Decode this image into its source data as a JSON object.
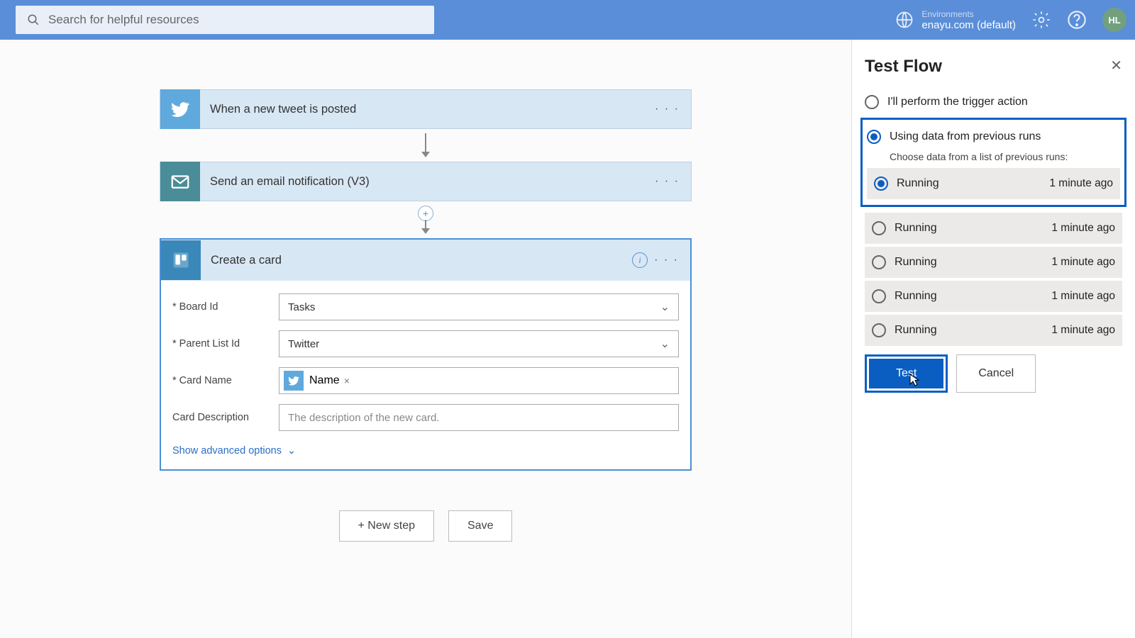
{
  "header": {
    "search_placeholder": "Search for helpful resources",
    "env_label": "Environments",
    "env_name": "enayu.com (default)",
    "avatar": "HL"
  },
  "flow": {
    "trigger": {
      "title": "When a new tweet is posted"
    },
    "action1": {
      "title": "Send an email notification (V3)"
    },
    "action2": {
      "title": "Create a card",
      "fields": {
        "board_label": "* Board Id",
        "board_value": "Tasks",
        "list_label": "* Parent List Id",
        "list_value": "Twitter",
        "name_label": "* Card Name",
        "name_token": "Name",
        "desc_label": "Card Description",
        "desc_placeholder": "The description of the new card."
      },
      "advanced": "Show advanced options"
    },
    "new_step": "+ New step",
    "save": "Save"
  },
  "panel": {
    "title": "Test Flow",
    "opt1": "I'll perform the trigger action",
    "opt2": "Using data from previous runs",
    "opt2_sub": "Choose data from a list of previous runs:",
    "runs": [
      {
        "status": "Running",
        "time": "1 minute ago",
        "selected": true
      },
      {
        "status": "Running",
        "time": "1 minute ago",
        "selected": false
      },
      {
        "status": "Running",
        "time": "1 minute ago",
        "selected": false
      },
      {
        "status": "Running",
        "time": "1 minute ago",
        "selected": false
      },
      {
        "status": "Running",
        "time": "1 minute ago",
        "selected": false
      }
    ],
    "test": "Test",
    "cancel": "Cancel"
  }
}
